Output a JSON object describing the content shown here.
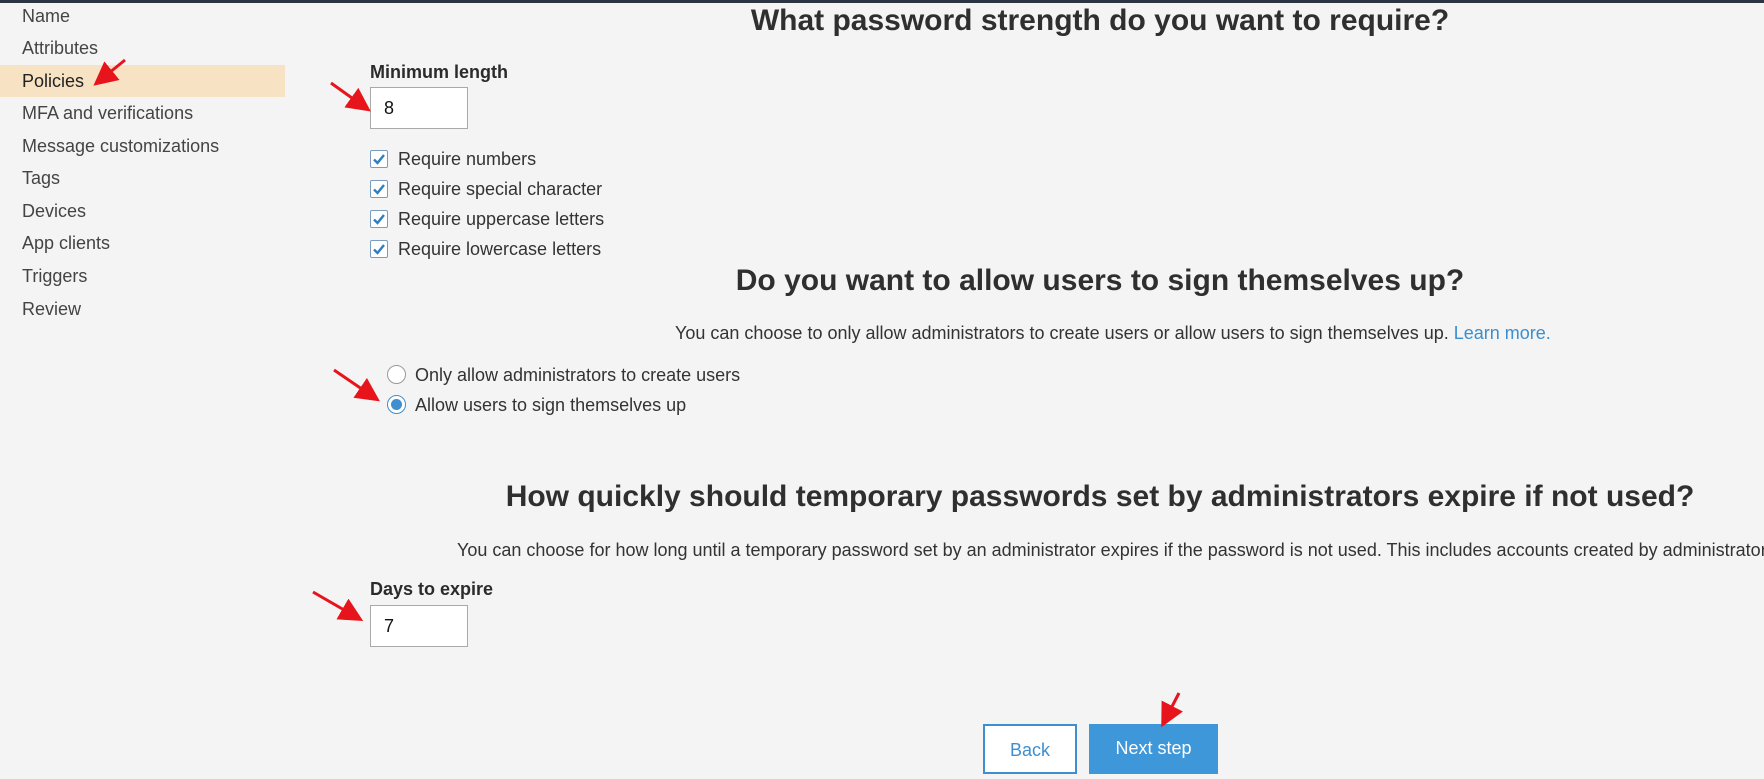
{
  "sidebar": {
    "items": [
      {
        "label": "Name"
      },
      {
        "label": "Attributes"
      },
      {
        "label": "Policies",
        "active": true
      },
      {
        "label": "MFA and verifications"
      },
      {
        "label": "Message customizations"
      },
      {
        "label": "Tags"
      },
      {
        "label": "Devices"
      },
      {
        "label": "App clients"
      },
      {
        "label": "Triggers"
      },
      {
        "label": "Review"
      }
    ]
  },
  "password": {
    "heading": "What password strength do you want to require?",
    "min_length_label": "Minimum length",
    "min_length_value": "8",
    "requirements": [
      {
        "label": "Require numbers",
        "checked": true
      },
      {
        "label": "Require special character",
        "checked": true
      },
      {
        "label": "Require uppercase letters",
        "checked": true
      },
      {
        "label": "Require lowercase letters",
        "checked": true
      }
    ]
  },
  "signup": {
    "heading": "Do you want to allow users to sign themselves up?",
    "description": "You can choose to only allow administrators to create users or allow users to sign themselves up.",
    "learn_more": "Learn more.",
    "options": [
      {
        "label": "Only allow administrators to create users",
        "selected": false
      },
      {
        "label": "Allow users to sign themselves up",
        "selected": true
      }
    ]
  },
  "expiry": {
    "heading": "How quickly should temporary passwords set by administrators expire if not used?",
    "description": "You can choose for how long until a temporary password set by an administrator expires if the password is not used. This includes accounts created by administrators.",
    "days_label": "Days to expire",
    "days_value": "7"
  },
  "buttons": {
    "back": "Back",
    "next": "Next step"
  },
  "colors": {
    "accent": "#3e97d8",
    "active_nav": "#f8e2c4",
    "annotation_arrow": "#e8141c"
  }
}
